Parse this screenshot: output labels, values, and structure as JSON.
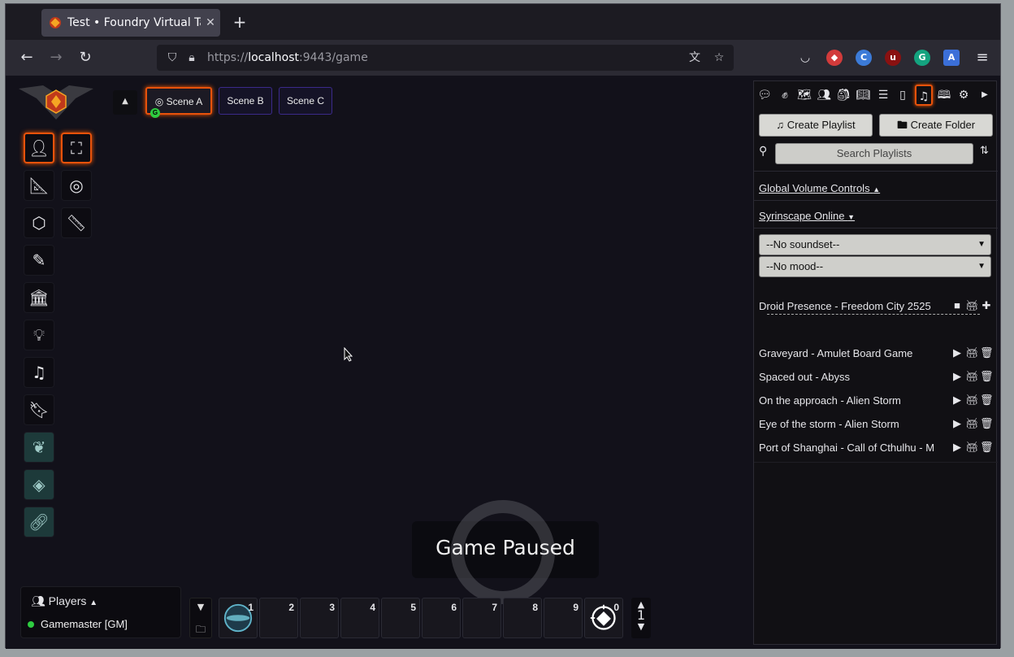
{
  "browser": {
    "tab_title": "Test • Foundry Virtual Tab",
    "url_prefix": "https://",
    "url_host": "localhost",
    "url_rest": ":9443/game"
  },
  "scenes": [
    {
      "label": "Scene A",
      "active": true
    },
    {
      "label": "Scene B",
      "active": false
    },
    {
      "label": "Scene C",
      "active": false
    }
  ],
  "gm_marker": "G",
  "pause_text": "Game Paused",
  "players": {
    "header": "Players",
    "list": [
      {
        "name": "Gamemaster [GM]",
        "status": "online"
      }
    ]
  },
  "hotbar": {
    "slots": [
      "1",
      "2",
      "3",
      "4",
      "5",
      "6",
      "7",
      "8",
      "9",
      "0"
    ],
    "page": "1"
  },
  "sidebar": {
    "create_playlist": "Create Playlist",
    "create_folder": "Create Folder",
    "search_placeholder": "Search Playlists",
    "global_volume": "Global Volume Controls",
    "syrinscape": "Syrinscape Online",
    "soundset": "--No soundset--",
    "mood": "--No mood--",
    "now_playing": "Droid Presence - Freedom City 2525",
    "playlists": [
      "Graveyard - Amulet Board Game",
      "Spaced out - Abyss",
      "On the approach - Alien Storm",
      "Eye of the storm - Alien Storm",
      "Port of Shanghai - Call of Cthulhu - M"
    ]
  },
  "colors": {
    "accent": "#e8520b",
    "online": "#2ecc40"
  }
}
